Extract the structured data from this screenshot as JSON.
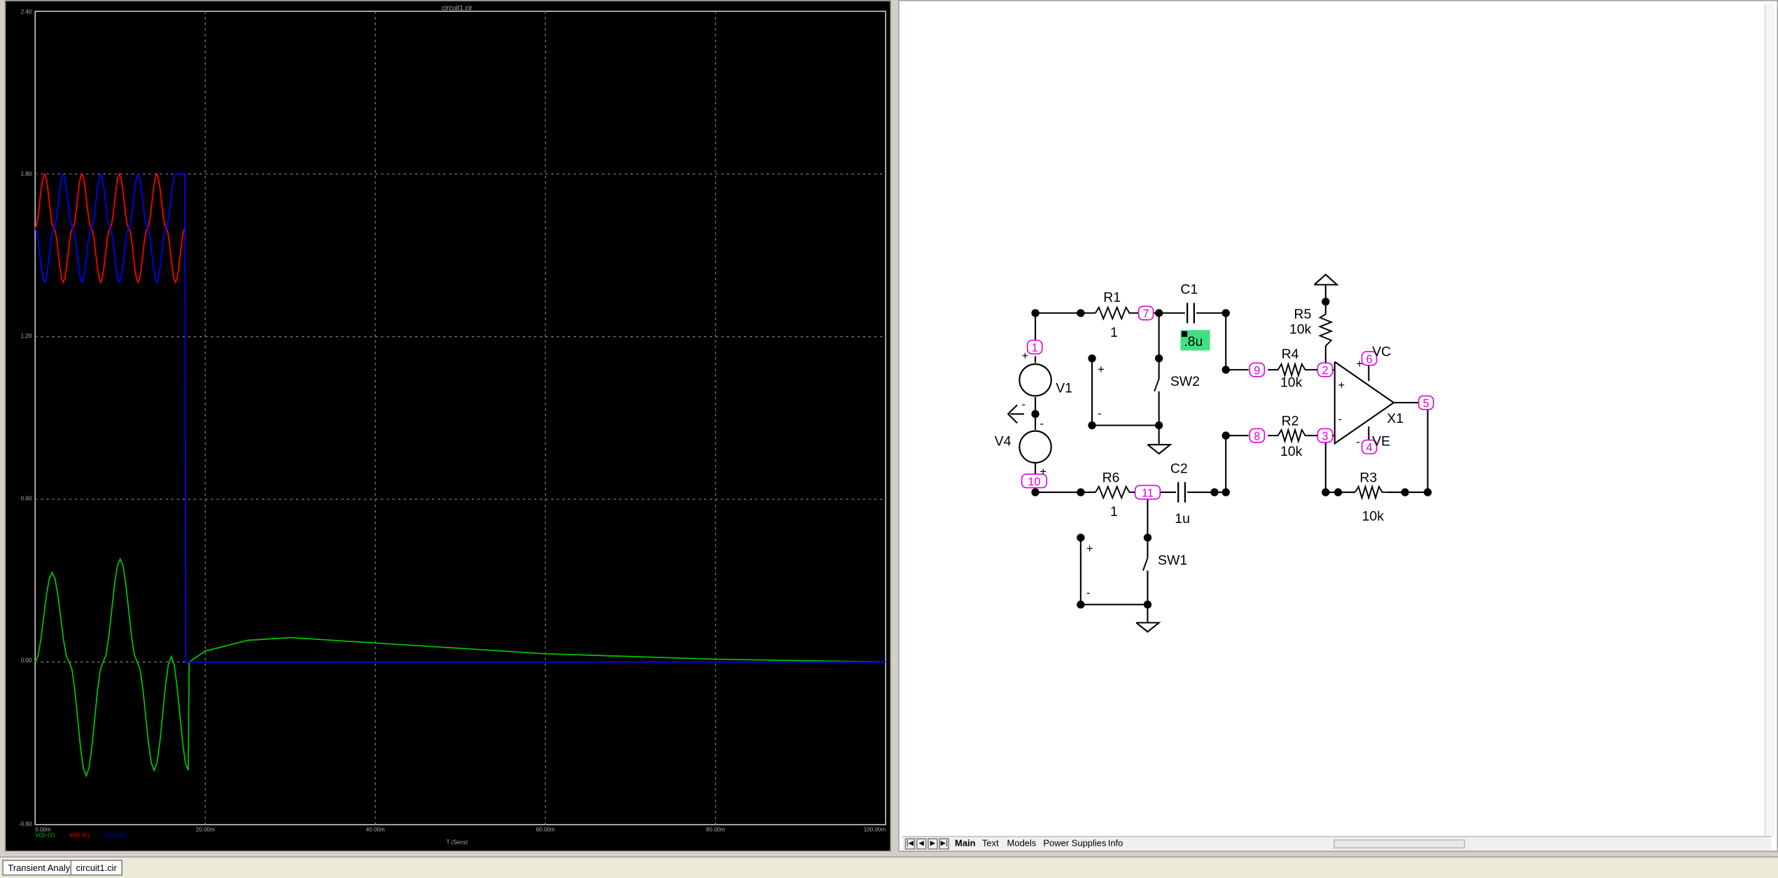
{
  "plot": {
    "title": "circuit1.cir",
    "x_axis_label": "T (Secs)",
    "x_ticks": [
      "0.00m",
      "20.00m",
      "40.00m",
      "60.00m",
      "80.00m",
      "100.00m"
    ],
    "y_ticks": [
      "2.40",
      "1.80",
      "1.20",
      "0.60",
      "0.00",
      "-0.60"
    ],
    "legend": [
      {
        "label": "V(3) (V)",
        "color": "#00c000"
      },
      {
        "label": "V(9) (V)",
        "color": "#ff0000"
      },
      {
        "label": "V(11) (V)",
        "color": "#0000ff"
      }
    ],
    "colors": {
      "background": "#000000",
      "grid": "#808080"
    }
  },
  "chart_data": {
    "type": "line",
    "title": "circuit1.cir",
    "xlabel": "T (Secs)",
    "ylabel": "",
    "xlim": [
      0,
      100
    ],
    "ylim": [
      -0.6,
      2.4
    ],
    "grid": true,
    "legend_placement": "bottom-left",
    "series": [
      {
        "name": "V(3) (V)",
        "color": "#00c000",
        "x": [
          0,
          2,
          4,
          6,
          8,
          10,
          12,
          14,
          16,
          18,
          18.1,
          20,
          25,
          30,
          40,
          50,
          60,
          70,
          80,
          90,
          100
        ],
        "values": [
          0,
          0.33,
          0,
          -0.42,
          0,
          0.38,
          0,
          -0.4,
          0.02,
          -0.4,
          0.0,
          0.04,
          0.08,
          0.09,
          0.07,
          0.05,
          0.03,
          0.02,
          0.01,
          0.005,
          0.0
        ]
      },
      {
        "name": "V(9) (V)",
        "color": "#ff0000",
        "x": [
          0,
          1.1,
          2.2,
          3.3,
          4.4,
          5.5,
          6.6,
          7.7,
          8.8,
          9.9,
          11,
          12.1,
          13.2,
          14.3,
          15.4,
          16.5,
          17.6
        ],
        "values": [
          1.6,
          1.8,
          1.6,
          1.4,
          1.6,
          1.8,
          1.6,
          1.4,
          1.6,
          1.8,
          1.6,
          1.4,
          1.6,
          1.8,
          1.6,
          1.4,
          1.6
        ]
      },
      {
        "name": "V(11) (V)",
        "color": "#0000ff",
        "x": [
          0,
          1.1,
          2.2,
          3.3,
          4.4,
          5.5,
          6.6,
          7.7,
          8.8,
          9.9,
          11,
          12.1,
          13.2,
          14.3,
          15.4,
          16.5,
          17.6,
          17.7,
          100
        ],
        "values": [
          1.6,
          1.4,
          1.6,
          1.8,
          1.6,
          1.4,
          1.6,
          1.8,
          1.6,
          1.4,
          1.6,
          1.8,
          1.6,
          1.4,
          1.6,
          1.8,
          1.8,
          0.0,
          0.0
        ]
      }
    ]
  },
  "schematic": {
    "components": {
      "r1": {
        "name": "R1",
        "value": "1"
      },
      "c1": {
        "name": "C1",
        "value": ".8u"
      },
      "sw2": {
        "name": "SW2"
      },
      "v1": {
        "name": "V1"
      },
      "v4": {
        "name": "V4"
      },
      "r6": {
        "name": "R6",
        "value": "1"
      },
      "c2": {
        "name": "C2",
        "value": "1u"
      },
      "sw1": {
        "name": "SW1"
      },
      "r5": {
        "name": "R5",
        "value": "10k"
      },
      "r4": {
        "name": "R4",
        "value": "10k"
      },
      "r2": {
        "name": "R2",
        "value": "10k"
      },
      "r3": {
        "name": "R3",
        "value": "10k"
      },
      "x1": {
        "name": "X1"
      },
      "vc": {
        "name": "VC"
      },
      "ve": {
        "name": "VE"
      }
    },
    "nodes": {
      "n1": "1",
      "n2": "2",
      "n3": "3",
      "n4": "4",
      "n5": "5",
      "n6": "6",
      "n7": "7",
      "n8": "8",
      "n9": "9",
      "n10": "10",
      "n11": "11"
    },
    "signs": {
      "plus": "+",
      "minus": "-"
    },
    "colors": {
      "node": "#e000e0",
      "highlight": "#40e080",
      "wire": "#000000"
    }
  },
  "sheet_tabs": [
    "Main",
    "Text",
    "Models",
    "Power Supplies",
    "Info"
  ],
  "nav_buttons": [
    "|◀",
    "◀",
    "▶",
    "▶|"
  ],
  "bottom_tabs": [
    "Transient Analysis",
    "circuit1.cir"
  ]
}
